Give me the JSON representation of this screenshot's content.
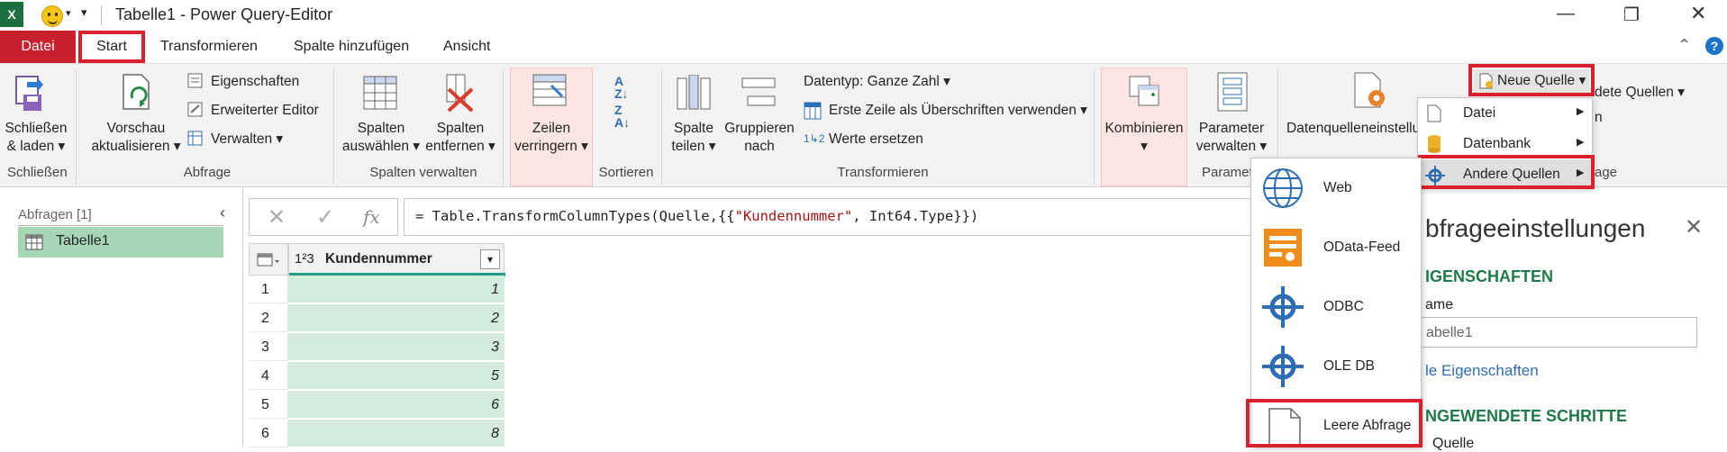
{
  "window": {
    "title": "Tabelle1 - Power Query-Editor"
  },
  "menu": {
    "tabs": [
      "Datei",
      "Start",
      "Transformieren",
      "Spalte hinzufügen",
      "Ansicht"
    ]
  },
  "ribbon": {
    "schliessen": {
      "line1": "Schließen",
      "line2": "& laden",
      "group": "Schließen"
    },
    "abfrage": {
      "vorschau_line1": "Vorschau",
      "vorschau_line2": "aktualisieren",
      "eigenschaften": "Eigenschaften",
      "erweiterter_editor": "Erweiterter Editor",
      "verwalten": "Verwalten",
      "group": "Abfrage"
    },
    "spalten": {
      "auswaehlen_line1": "Spalten",
      "auswaehlen_line2": "auswählen",
      "entfernen_line1": "Spalten",
      "entfernen_line2": "entfernen",
      "group": "Spalten verwalten"
    },
    "zeilen": {
      "line1": "Zeilen",
      "line2": "verringern"
    },
    "sortieren": {
      "group": "Sortieren"
    },
    "transformieren": {
      "spalte_teilen_line1": "Spalte",
      "spalte_teilen_line2": "teilen",
      "gruppieren_line1": "Gruppieren",
      "gruppieren_line2": "nach",
      "datentyp": "Datentyp: Ganze Zahl",
      "erste_zeile": "Erste Zeile als Überschriften verwenden",
      "werte_ersetzen": "Werte ersetzen",
      "group": "Transformieren"
    },
    "kombinieren": {
      "label": "Kombinieren"
    },
    "parameter": {
      "line1": "Parameter",
      "line2": "verwalten",
      "group_partial": "Paramet"
    },
    "datenquellen": {
      "label_partial": "Datenquelleneinstellu"
    },
    "neue_quelle": {
      "label": "Neue Quelle",
      "zuletzt_partial": "dete Quellen",
      "n_partial": "n",
      "group_partial": "age"
    }
  },
  "neue_quelle_menu": {
    "items": [
      "Datei",
      "Datenbank",
      "Andere Quellen"
    ]
  },
  "andere_quellen_menu": {
    "items": [
      "Web",
      "OData-Feed",
      "ODBC",
      "OLE DB",
      "Leere Abfrage"
    ]
  },
  "queries": {
    "header": "Abfragen [1]",
    "items": [
      "Tabelle1"
    ]
  },
  "formula": {
    "text_prefix": "= Table.TransformColumnTypes(Quelle,{{",
    "text_string": "\"Kundennummer\"",
    "text_suffix": ", Int64.Type}})",
    "fx": "fx"
  },
  "grid": {
    "column_header": "Kundennummer",
    "type_icon": "1²3",
    "row_numbers": [
      "1",
      "2",
      "3",
      "4",
      "5",
      "6"
    ],
    "values": [
      "1",
      "2",
      "3",
      "5",
      "6",
      "8"
    ]
  },
  "settings": {
    "title_partial": "bfrageeinstellungen",
    "eigenschaften_partial": "IGENSCHAFTEN",
    "name_label_partial": "ame",
    "name_value_partial": "abelle1",
    "link_partial": "le Eigenschaften",
    "schritte_partial": "NGEWENDETE SCHRITTE",
    "step_partial": "Quelle"
  },
  "colors": {
    "accent_red": "#d9202c",
    "excel_green": "#1d6f42",
    "grid_green": "#d4ecdf",
    "header_green": "#1f9e85"
  }
}
